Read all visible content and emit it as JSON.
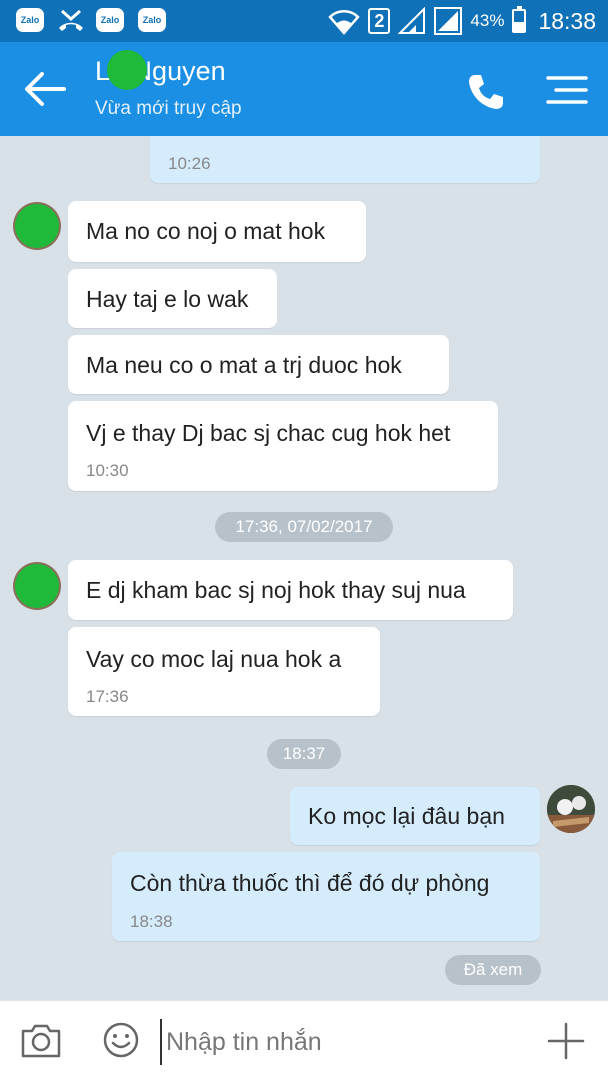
{
  "status_bar": {
    "app_icons": [
      "Zalo",
      "Zalo",
      "Zalo"
    ],
    "sim": "2",
    "battery": "43%",
    "time": "18:38"
  },
  "header": {
    "name_prefix": "L",
    "name_rest": "n Nguyen",
    "status": "Vừa mới truy cập",
    "icons": {
      "back": "arrow-left-icon",
      "call": "phone-icon",
      "menu": "menu-icon"
    }
  },
  "messages": {
    "top_partial_time": "10:26",
    "m1": "Ma no co noj o mat hok",
    "m2": "Hay taj e lo wak",
    "m3": "Ma neu co o mat a trj duoc hok",
    "m4": "Vj e thay Dj bac sj chac cug hok het",
    "m4_time": "10:30",
    "date1": "17:36, 07/02/2017",
    "m5": "E dj kham bac sj noj hok thay suj nua",
    "m6": "Vay co moc laj nua hok a",
    "m6_time": "17:36",
    "date2": "18:37",
    "me1": "Ko mọc lại đâu bạn",
    "me2": "Còn thừa thuốc thì để đó dự phòng",
    "me2_time": "18:38",
    "seen": "Đã xem"
  },
  "input": {
    "placeholder": "Nhập tin nhắn",
    "value": ""
  },
  "colors": {
    "header": "#1a8fe3",
    "statusbar": "#0f71b8",
    "chat_bg": "#d9e1e8",
    "my_bubble": "#d5ecfc"
  }
}
